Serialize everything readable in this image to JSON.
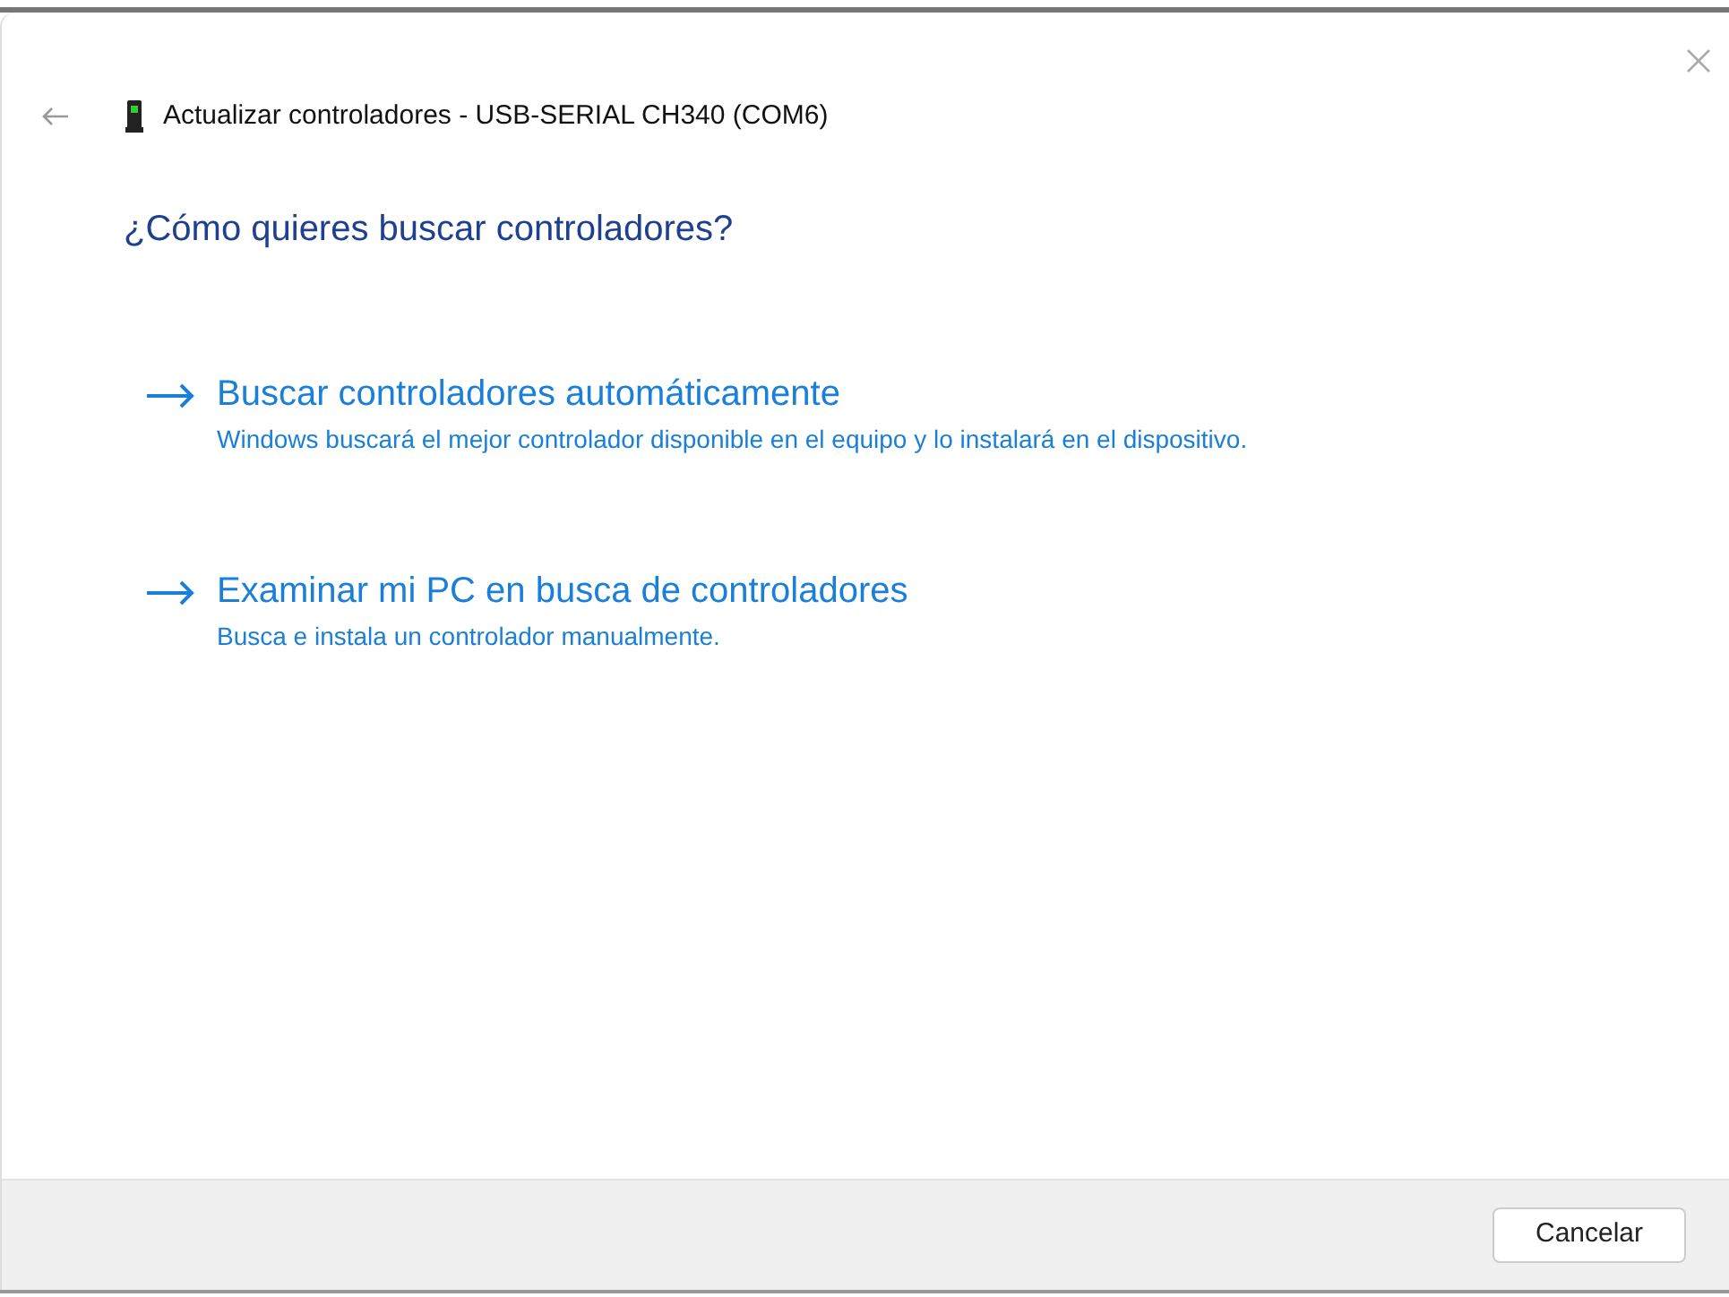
{
  "window": {
    "title": "Actualizar controladores - USB-SERIAL CH340 (COM6)"
  },
  "heading": "¿Cómo quieres buscar controladores?",
  "options": [
    {
      "title": "Buscar controladores automáticamente",
      "description": "Windows buscará el mejor controlador disponible en el equipo y lo instalará en el dispositivo."
    },
    {
      "title": "Examinar mi PC en busca de controladores",
      "description": "Busca e instala un controlador manualmente."
    }
  ],
  "buttons": [
    "Cancelar"
  ]
}
